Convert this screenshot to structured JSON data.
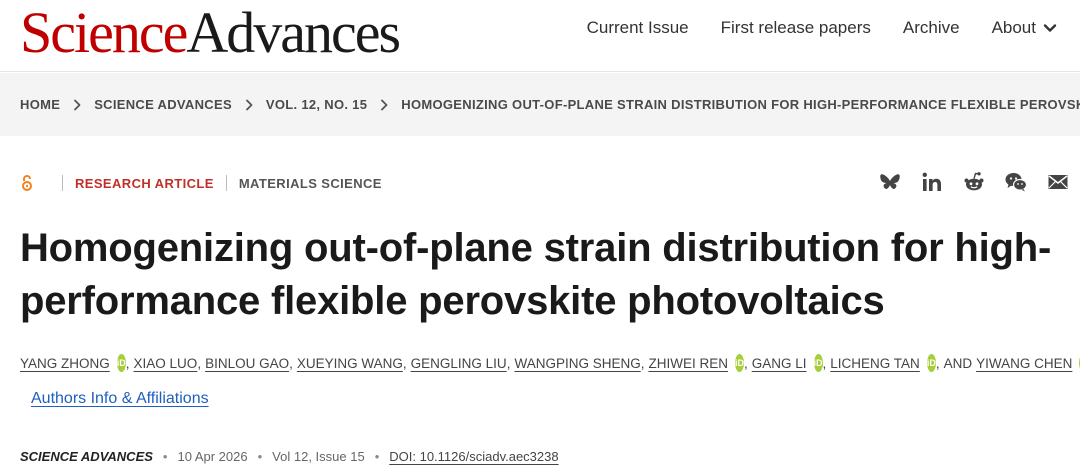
{
  "header": {
    "logo": {
      "science": "Science",
      "advances": "Advances"
    },
    "nav": {
      "current_issue": "Current Issue",
      "first_release": "First release papers",
      "archive": "Archive",
      "about": "About"
    }
  },
  "breadcrumb": [
    "HOME",
    "SCIENCE ADVANCES",
    "VOL. 12, NO. 15",
    "HOMOGENIZING OUT-OF-PLANE STRAIN DISTRIBUTION FOR HIGH-PERFORMANCE FLEXIBLE PEROVSKITE..."
  ],
  "article": {
    "type": "RESEARCH ARTICLE",
    "subject": "MATERIALS SCIENCE",
    "title": "Homogenizing out-of-plane strain distribution for high-performance flexible perovskite photovoltaics",
    "authors": {
      "a1": "YANG ZHONG",
      "a2": "XIAO LUO",
      "a3": "BINLOU GAO",
      "a4": "XUEYING WANG",
      "a5": "GENGLING LIU",
      "a6": "WANGPING SHENG",
      "a7": "ZHIWEI REN",
      "a8": "GANG LI",
      "a9": "LICHENG TAN",
      "and": "AND",
      "a10": "YIWANG CHEN",
      "orcid_label": "iD"
    },
    "affiliations_link": "Authors Info & Affiliations",
    "citation": {
      "journal": "SCIENCE ADVANCES",
      "date": "10 Apr 2026",
      "volume": "Vol 12, Issue 15",
      "doi": "DOI: 10.1126/sciadv.aec3238"
    }
  },
  "share_icons": [
    "bluesky-icon",
    "linkedin-icon",
    "reddit-icon",
    "wechat-icon",
    "email-icon"
  ],
  "colors": {
    "brand_red": "#c00000",
    "article_type": "#c0302a",
    "orcid_green": "#a6ce39",
    "link_blue": "#1f5fbf",
    "open_access_orange": "#f58220"
  }
}
